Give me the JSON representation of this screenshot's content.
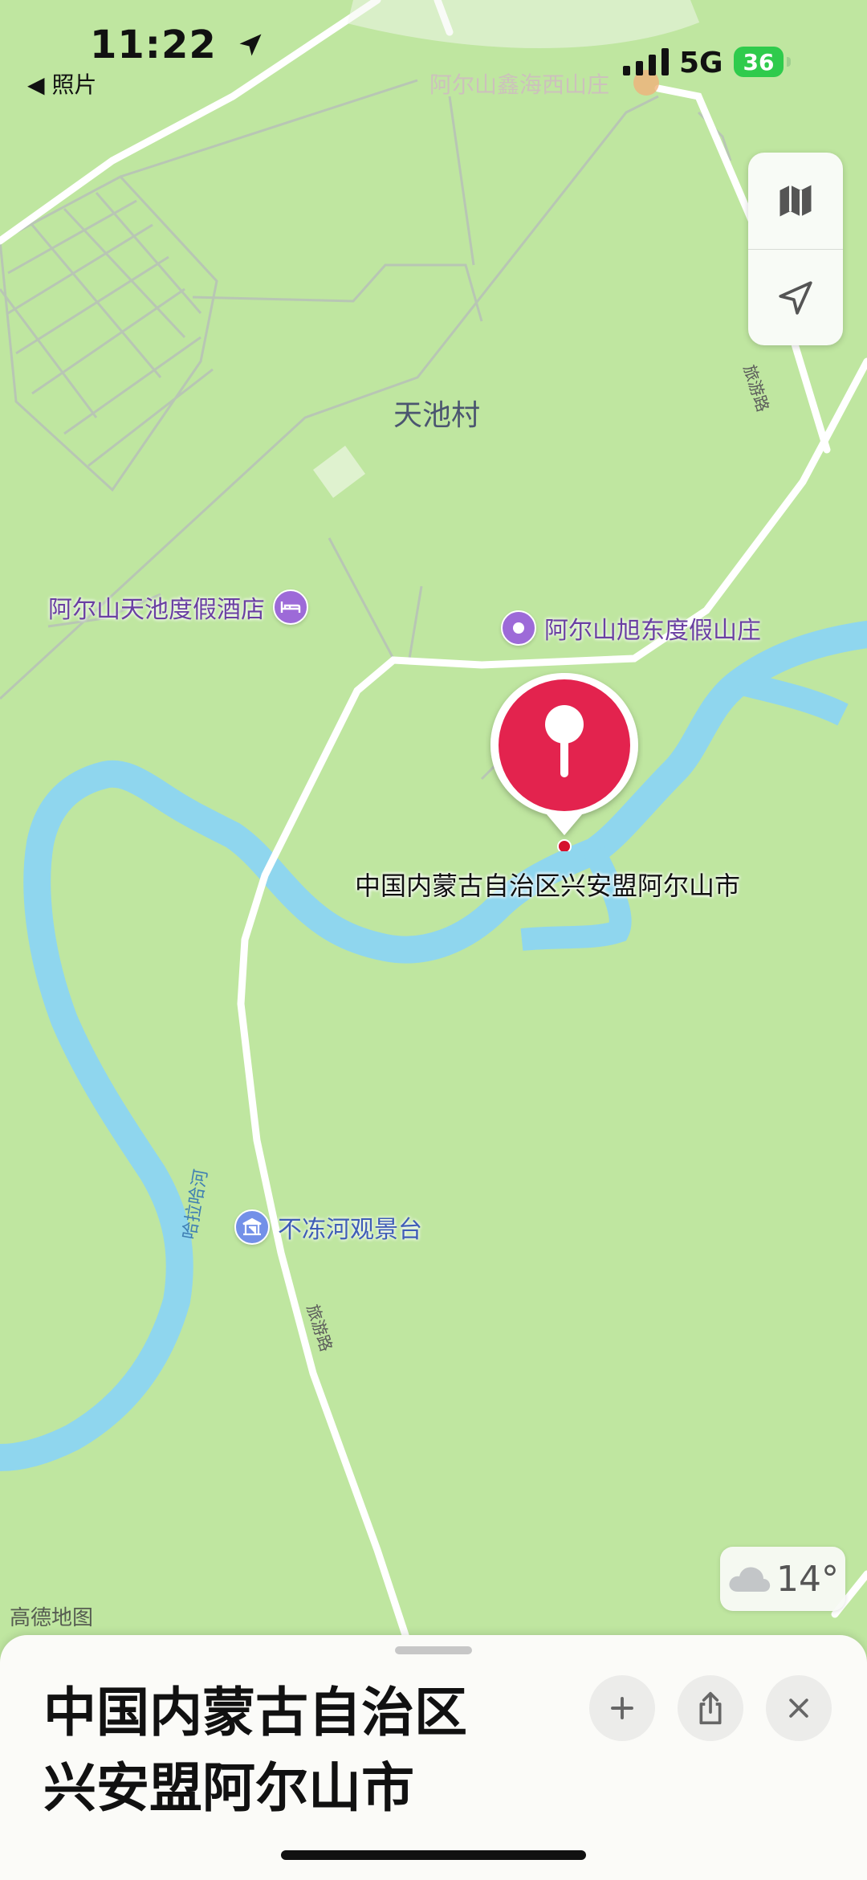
{
  "status_bar": {
    "time": "11:22",
    "back_app": "照片",
    "network": "5G",
    "battery": "36"
  },
  "map": {
    "village": "天池村",
    "pois": [
      {
        "name": "阿尔山天池度假酒店",
        "icon": "bed-icon"
      },
      {
        "name": "阿尔山旭东度假山庄",
        "icon": "dot-icon"
      },
      {
        "name": "不冻河观景台",
        "icon": "pavilion-icon"
      }
    ],
    "faded_poi": "阿尔山鑫海西山庄",
    "roads": [
      "旅游路",
      "旅游路"
    ],
    "river": "哈拉哈河",
    "pin_label": "中国内蒙古自治区兴安盟阿尔山市",
    "attribution": "高德地图",
    "colors": {
      "land": "#bfe6a0",
      "water": "#8fd6ee",
      "road": "#ffffff",
      "pin": "#e8234f"
    }
  },
  "weather": {
    "temperature": "14°",
    "icon": "cloud-icon"
  },
  "sheet": {
    "title_line1": "中国内蒙古自治区",
    "title_line2": "兴安盟阿尔山市"
  }
}
